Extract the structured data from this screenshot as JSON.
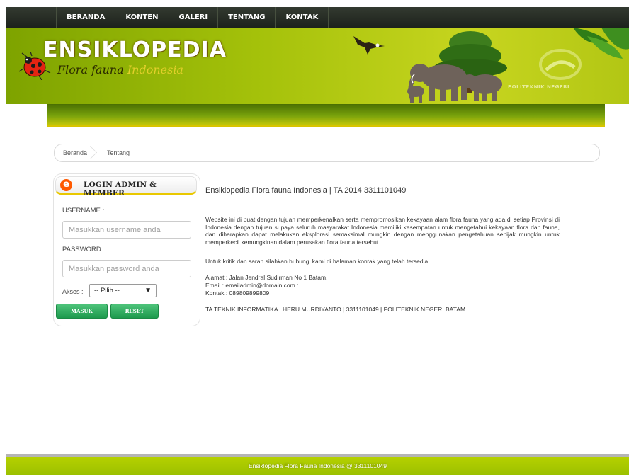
{
  "nav": {
    "items": [
      "BERANDA",
      "KONTEN",
      "GALERI",
      "TENTANG",
      "KONTAK"
    ]
  },
  "banner": {
    "logo": "ENSIKLOPEDIA",
    "subtitle_part1": "Flora fauna ",
    "subtitle_part2": "Indonesia",
    "org": "POLITEKNIK NEGERI",
    "icons": [
      "ladybug-icon",
      "eagle-icon",
      "tree-icon",
      "elephant-icon",
      "leaves-icon",
      "polibatam-logo-icon"
    ]
  },
  "breadcrumb": {
    "items": [
      "Beranda",
      "Tentang"
    ]
  },
  "login": {
    "title": "LOGIN ADMIN & MEMBER",
    "username_label": "USERNAME :",
    "username_placeholder": "Masukkan username anda",
    "password_label": "PASSWORD :",
    "password_placeholder": "Masukkan password anda",
    "akses_label": "Akses :",
    "akses_selected": "-- Pilih --",
    "masuk_label": "MASUK",
    "reset_label": "RESET",
    "accent_color": "#ff5a00"
  },
  "content": {
    "title": "Ensiklopedia Flora fauna Indonesia | TA 2014 3311101049",
    "paragraph": "Website ini di buat dengan tujuan memperkenalkan serta mempromosikan kekayaan alam flora fauna yang ada di setiap Provinsi di Indonesia dengan tujuan supaya seluruh masyarakat Indonesia memiliki kesempatan untuk mengetahui kekayaan flora dan fauna, dan diharapkan dapat melakukan eksplorasi semaksimal mungkin dengan menggunakan pengetahuan sebijak mungkin untuk memperkecil kemungkinan dalam perusakan flora fauna tersebut.",
    "contact_note": "Untuk kritik dan saran silahkan hubungi kami di halaman kontak yang telah tersedia.",
    "alamat": "Alamat : Jalan Jendral Sudirman No 1 Batam,",
    "email": "Email : emailadmin@domain.com :",
    "kontak": "Kontak : 089809899809",
    "credits": "TA TEKNIK INFORMATIKA | HERU MURDIYANTO | 3311101049 | POLITEKNIK NEGERI BATAM"
  },
  "footer": {
    "text": "Ensiklopedia Flora Fauna Indonesia @ 3311101049"
  }
}
